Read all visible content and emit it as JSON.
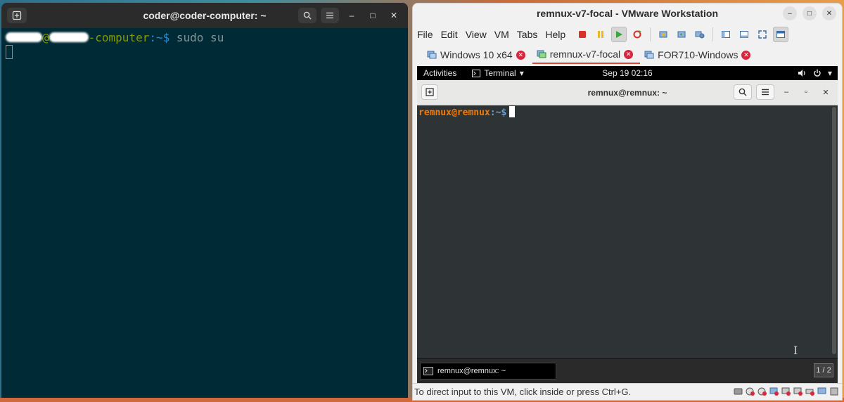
{
  "left_terminal": {
    "title": "coder@coder-computer: ~",
    "prompt_host": "-computer",
    "prompt_path": ":~$",
    "command": "sudo su"
  },
  "vmware": {
    "title": "remnux-v7-focal - VMware Workstation",
    "menu": [
      "File",
      "Edit",
      "View",
      "VM",
      "Tabs",
      "Help"
    ],
    "tabs": [
      {
        "label": "Windows 10 x64",
        "active": false
      },
      {
        "label": "remnux-v7-focal",
        "active": true
      },
      {
        "label": "FOR710-Windows",
        "active": false
      }
    ],
    "status_text": "To direct input to this VM, click inside or press Ctrl+G."
  },
  "guest": {
    "activities": "Activities",
    "app_menu": "Terminal",
    "clock": "Sep 19  02:16",
    "terminal_title": "remnux@remnux: ~",
    "prompt_user": "remnux@remnux",
    "prompt_path": ":~$",
    "taskbar_item": "remnux@remnux: ~",
    "workspace": "1 / 2"
  },
  "colors": {
    "solarized_bg": "#002b36",
    "prompt_green": "#859900",
    "prompt_blue": "#268bd2",
    "remnux_orange": "#f57900",
    "tab_close_red": "#d7263d"
  }
}
